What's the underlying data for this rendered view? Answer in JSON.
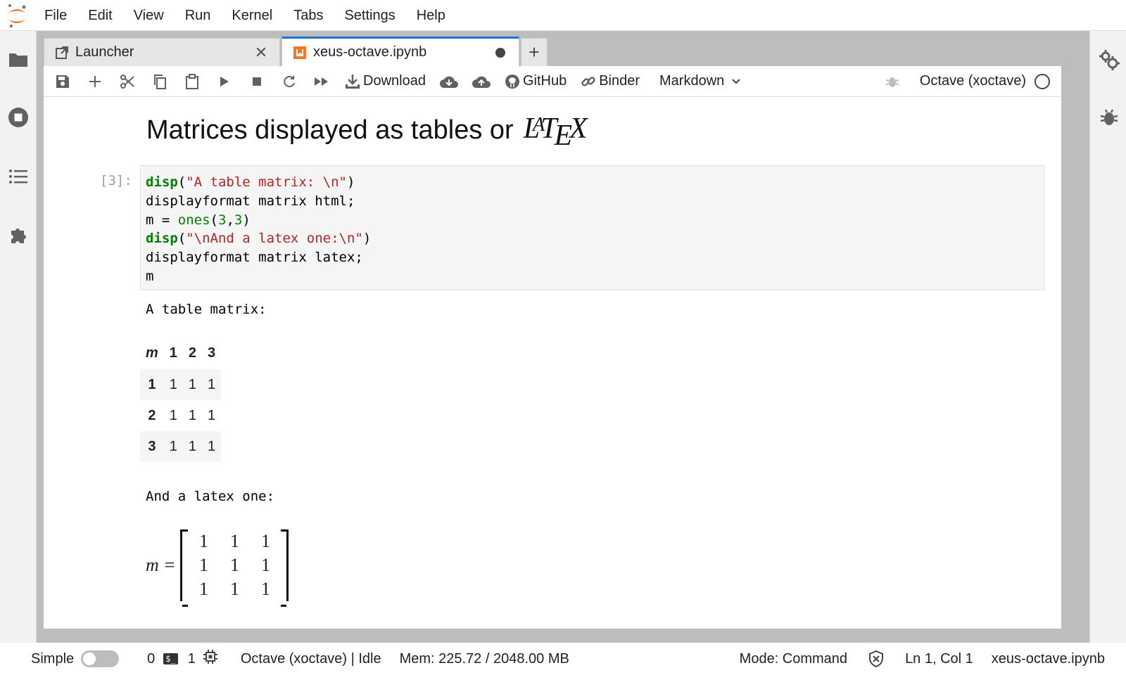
{
  "menu": [
    "File",
    "Edit",
    "View",
    "Run",
    "Kernel",
    "Tabs",
    "Settings",
    "Help"
  ],
  "tabs": {
    "launcher": "Launcher",
    "notebook": "xeus-octave.ipynb",
    "add": "+"
  },
  "toolbar": {
    "download": "Download",
    "github": "GitHub",
    "binder": "Binder",
    "cell_type": "Markdown",
    "kernel": "Octave (xoctave)"
  },
  "notebook": {
    "heading": "Matrices displayed as tables or",
    "heading_logo": "LaTeX",
    "prompt": "[3]:",
    "code": {
      "l1_fn": "disp",
      "l1_open": "(",
      "l1_str": "\"A table matrix: \\n\"",
      "l1_close": ")",
      "l2": "displayformat matrix html;",
      "l3_pre": "m = ",
      "l3_fn": "ones",
      "l3_open": "(",
      "l3_a": "3",
      "l3_comma": ",",
      "l3_b": "3",
      "l3_close": ")",
      "l4_fn": "disp",
      "l4_open": "(",
      "l4_str": "\"\\nAnd a latex one:\\n\"",
      "l4_close": ")",
      "l5": "displayformat matrix latex;",
      "l6": "m"
    },
    "output1": "A table matrix:",
    "table": {
      "corner": "m",
      "headers": [
        "1",
        "2",
        "3"
      ],
      "rows": [
        {
          "label": "1",
          "cells": [
            "1",
            "1",
            "1"
          ]
        },
        {
          "label": "2",
          "cells": [
            "1",
            "1",
            "1"
          ]
        },
        {
          "label": "3",
          "cells": [
            "1",
            "1",
            "1"
          ]
        }
      ]
    },
    "output2": "And a latex one:",
    "latex": {
      "var": "m",
      "eq": "=",
      "matrix": [
        [
          "1",
          "1",
          "1"
        ],
        [
          "1",
          "1",
          "1"
        ],
        [
          "1",
          "1",
          "1"
        ]
      ]
    }
  },
  "status": {
    "mode_label": "Simple",
    "terminals": "0",
    "kernels": "1",
    "kernel_status": "Octave (xoctave) | Idle",
    "memory": "Mem: 225.72 / 2048.00 MB",
    "mode": "Mode: Command",
    "cursor": "Ln 1, Col 1",
    "file": "xeus-octave.ipynb"
  },
  "colors": {
    "accent": "#1976d2",
    "jupyter_orange": "#f37726",
    "keyword": "#008000",
    "string": "#ba2121"
  }
}
